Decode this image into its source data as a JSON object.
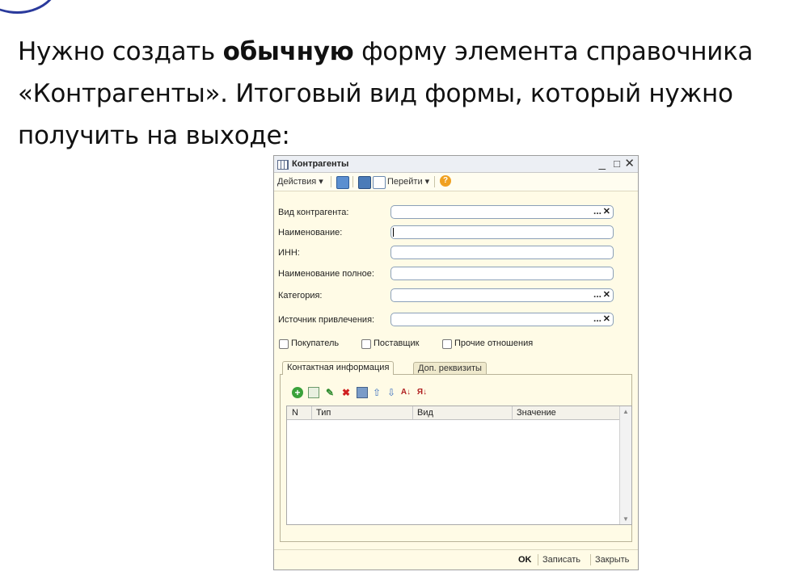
{
  "intro": {
    "part1": "Нужно создать ",
    "bold": "обычную",
    "part2": " форму элемента справочника «Контрагенты». Итоговый вид формы, который нужно получить на выходе:"
  },
  "window": {
    "title": "Контрагенты",
    "controls": {
      "minimize": "_",
      "maximize": "□",
      "close": "✕"
    }
  },
  "toolbar": {
    "actions": "Действия ▾",
    "goto": "Перейти ▾",
    "help": "?"
  },
  "fields": [
    {
      "label": "Вид контрагента:",
      "type": "select"
    },
    {
      "label": "Наименование:",
      "type": "text",
      "focused": true
    },
    {
      "label": "ИНН:",
      "type": "text"
    },
    {
      "label": "Наименование полное:",
      "type": "text"
    },
    {
      "label": "Категория:",
      "type": "select"
    },
    {
      "label": "Источник привлечения:",
      "type": "select"
    }
  ],
  "field_buttons": {
    "choose": "...",
    "clear": "✕"
  },
  "checkboxes": [
    "Покупатель",
    "Поставщик",
    "Прочие отношения"
  ],
  "tabs": [
    {
      "label": "Контактная информация",
      "active": true
    },
    {
      "label": "Доп. реквизиты",
      "active": false
    }
  ],
  "grid": {
    "icons": [
      "add-icon",
      "copy-icon",
      "edit-icon",
      "delete-icon",
      "save-icon",
      "move-up-icon",
      "move-down-icon",
      "sort-asc-icon",
      "sort-desc-icon"
    ],
    "columns": [
      "N",
      "Тип",
      "Вид",
      "Значение"
    ],
    "rows": []
  },
  "footer": {
    "ok": "OK",
    "save": "Записать",
    "close": "Закрыть"
  }
}
